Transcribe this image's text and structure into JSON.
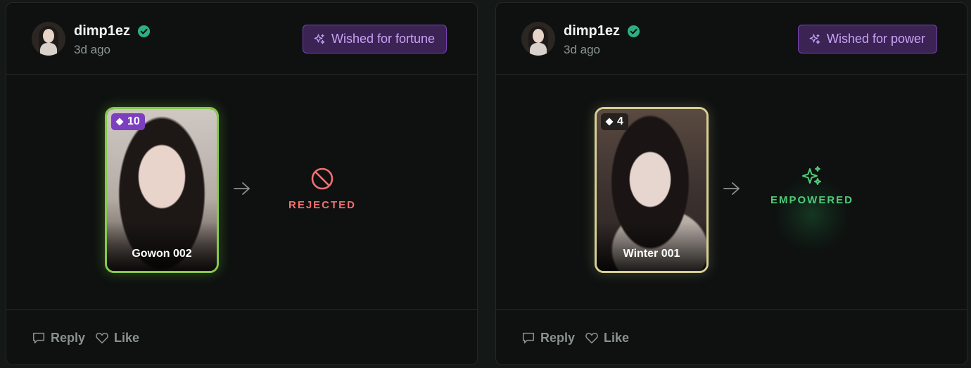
{
  "posts": [
    {
      "user": "dimp1ez",
      "time": "3d ago",
      "wish": "Wished for fortune",
      "card": {
        "level": "10",
        "name": "Gowon 002"
      },
      "outcome": "REJECTED",
      "actions": {
        "reply": "Reply",
        "like": "Like"
      }
    },
    {
      "user": "dimp1ez",
      "time": "3d ago",
      "wish": "Wished for power",
      "card": {
        "level": "4",
        "name": "Winter 001"
      },
      "outcome": "EMPOWERED",
      "actions": {
        "reply": "Reply",
        "like": "Like"
      }
    }
  ],
  "colors": {
    "verified": "#2fae86",
    "wish_badge_bg": "#3b2354",
    "wish_badge_text": "#c9a3f5",
    "rejected": "#f07070",
    "empowered": "#4fcc78"
  },
  "icons": [
    "verified-icon",
    "sparkles-icon",
    "diamond-icon",
    "arrow-right-icon",
    "prohibited-icon",
    "comment-icon",
    "heart-icon"
  ]
}
